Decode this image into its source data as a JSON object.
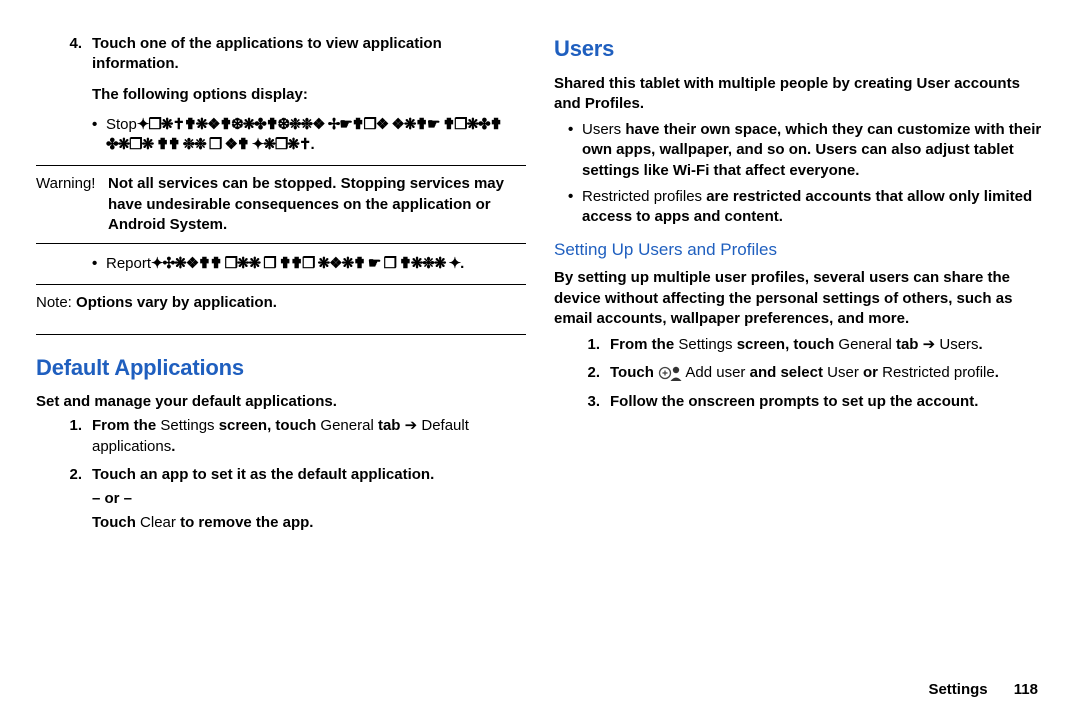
{
  "left": {
    "item4_a": "Touch one of the applications to view application information.",
    "item4_b": "The following options display:",
    "stop_label": "Stop",
    "stop_garble": "✦❒❋✝✟❋❖✟❆❋✤✟❆❉❉❖ ✢☛✟❒❖ ❖❋✟☛ ✟❒❋✤✟ ✤❋❒❋ ✟✟ ❉❉ ❒ ❖✟ ✦❋❒❋✝.",
    "warning_label": "Warning!",
    "warning_body": "Not all services can be stopped. Stopping services may have undesirable consequences on the application or Android System.",
    "report_label": "Report",
    "report_garble": "✦✣❋❖✟✟ ❒❋❋ ❒ ✟✟❒ ❋❖❋✟ ☛ ❒ ✟❋❉❋ ✦.",
    "note_label": "Note:",
    "note_body": "Options vary by application.",
    "h1": "Default Applications",
    "da_intro": "Set and manage your default applications.",
    "da_1_a": "From the ",
    "da_1_b": "Settings",
    "da_1_c": " screen, touch ",
    "da_1_d": "General",
    "da_1_e": " tab",
    "da_1_f": "Default applications",
    "da_2_a": "Touch an app to set it as the default application.",
    "da_2_or": "– or –",
    "da_2_b1": "Touch ",
    "da_2_b2": "Clear",
    "da_2_b3": " to remove the app."
  },
  "right": {
    "h1": "Users",
    "intro": "Shared this tablet with multiple people by creating User accounts and Profiles.",
    "b1_a": "Users",
    "b1_b": " have their own space, which they can customize with their own apps, wallpaper, and so on. Users can also adjust tablet settings like Wi-Fi that affect everyone.",
    "b2_a": "Restricted profiles",
    "b2_b": " are restricted accounts that allow only limited access to apps and content.",
    "h2": "Setting Up Users and Profiles",
    "sub_intro": "By setting up multiple user profiles, several users can share the device without affecting the personal settings of others, such as email accounts, wallpaper preferences, and more.",
    "s1_a": "From the ",
    "s1_b": "Settings",
    "s1_c": " screen, touch ",
    "s1_d": "General",
    "s1_e": " tab",
    "s1_f": "Users",
    "s2_a": "Touch ",
    "s2_b": "Add user",
    "s2_c": " and select ",
    "s2_d": "User",
    "s2_e": " or ",
    "s2_f": "Restricted profile",
    "s3": "Follow the onscreen prompts to set up the account."
  },
  "footer": {
    "section": "Settings",
    "page": "118"
  }
}
